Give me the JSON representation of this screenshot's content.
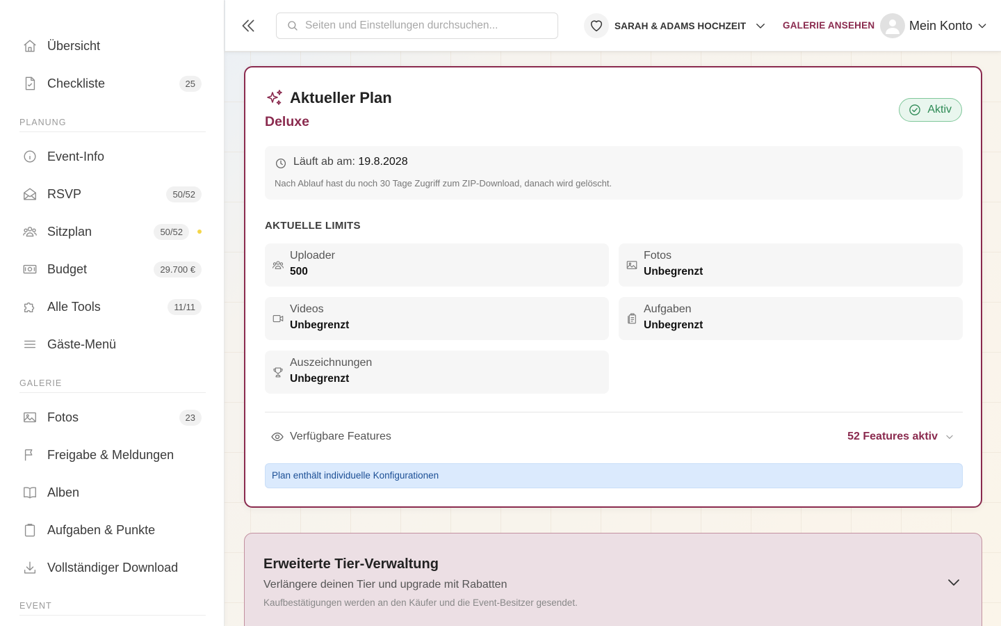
{
  "sidebar": {
    "top_items": [
      {
        "label": "Übersicht",
        "badge": null
      },
      {
        "label": "Checkliste",
        "badge": "25"
      }
    ],
    "sections": [
      {
        "title": "PLANUNG",
        "items": [
          {
            "label": "Event-Info",
            "badge": null
          },
          {
            "label": "RSVP",
            "badge": "50/52"
          },
          {
            "label": "Sitzplan",
            "badge": "50/52",
            "dot_color": "#f4d64a"
          },
          {
            "label": "Budget",
            "badge": "29.700 €"
          },
          {
            "label": "Alle Tools",
            "badge": "11/11"
          },
          {
            "label": "Gäste-Menü",
            "badge": null
          }
        ]
      },
      {
        "title": "GALERIE",
        "items": [
          {
            "label": "Fotos",
            "badge": "23"
          },
          {
            "label": "Freigabe & Meldungen",
            "badge": null
          },
          {
            "label": "Alben",
            "badge": null
          },
          {
            "label": "Aufgaben & Punkte",
            "badge": null
          },
          {
            "label": "Vollständiger Download",
            "badge": null
          }
        ]
      },
      {
        "title": "EVENT",
        "items": []
      }
    ]
  },
  "header": {
    "search_placeholder": "Seiten und Einstellungen durchsuchen...",
    "event_name": "SARAH & ADAMS HOCHZEIT",
    "gallery_link": "GALERIE ANSEHEN",
    "account_label": "Mein Konto"
  },
  "plan": {
    "title": "Aktueller Plan",
    "name": "Deluxe",
    "status": "Aktiv",
    "expiry_label": "Läuft ab am:",
    "expiry_date": "19.8.2028",
    "expiry_note": "Nach Ablauf hast du noch 30 Tage Zugriff zum ZIP-Download, danach wird gelöscht.",
    "limits_title": "AKTUELLE LIMITS",
    "limits": [
      {
        "label": "Uploader",
        "value": "500",
        "icon": "users-icon"
      },
      {
        "label": "Fotos",
        "value": "Unbegrenzt",
        "icon": "image-icon"
      },
      {
        "label": "Videos",
        "value": "Unbegrenzt",
        "icon": "video-icon"
      },
      {
        "label": "Aufgaben",
        "value": "Unbegrenzt",
        "icon": "tasks-icon"
      },
      {
        "label": "Auszeichnungen",
        "value": "Unbegrenzt",
        "icon": "trophy-icon"
      }
    ],
    "features_label": "Verfügbare Features",
    "features_count": "52 Features aktiv",
    "config_note": "Plan enthält individuelle Konfigurationen"
  },
  "tier": {
    "title": "Erweiterte Tier-Verwaltung",
    "subtitle": "Verlängere deinen Tier und upgrade mit Rabatten",
    "note": "Kaufbestätigungen werden an den Käufer und die Event-Besitzer gesendet."
  },
  "colors": {
    "accent": "#8a2a4e",
    "active_green": "#2e8a55",
    "info_blue": "#1c4f95",
    "notification_dot": "#f4d64a"
  }
}
